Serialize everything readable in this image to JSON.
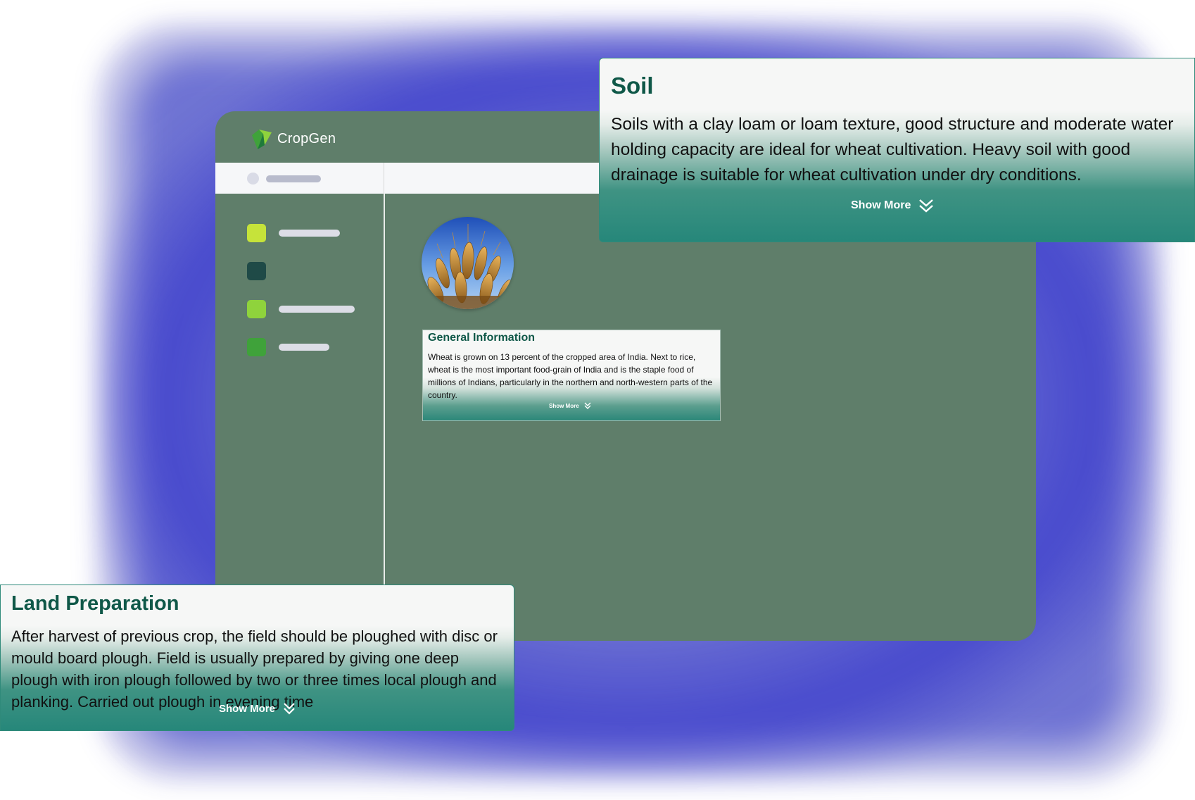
{
  "app": {
    "brand": "CropGen"
  },
  "colors": {
    "app_bg": "#5f7e6a",
    "accent_teal": "#0f5848",
    "nav_1": "#c6e33a",
    "nav_2": "#1f4a47",
    "nav_3": "#8fd33c",
    "nav_4": "#3fa23a"
  },
  "sidebar": {
    "items": [
      {
        "icon": "lime-square-icon",
        "color": "#c6e33a"
      },
      {
        "icon": "dark-teal-square-icon",
        "color": "#1f4a47"
      },
      {
        "icon": "green-square-icon",
        "color": "#8fd33c"
      },
      {
        "icon": "forest-green-square-icon",
        "color": "#3fa23a"
      }
    ]
  },
  "main": {
    "crop_image": "wheat-image",
    "general_info": {
      "title": "General Information",
      "body": "Wheat is grown on 13 percent of the cropped area of India. Next to rice, wheat is the most important food-grain of India and is the staple food of millions of Indians, particularly in the northern and north-western parts of the country.",
      "show_more": "Show More"
    }
  },
  "soil_card": {
    "title": "Soil",
    "body": "Soils with a clay loam or loam texture, good structure and moderate water holding capacity are ideal for wheat cultivation. Heavy soil with good drainage is suitable for wheat cultivation under dry conditions.",
    "show_more": "Show More"
  },
  "land_card": {
    "title": "Land Preparation",
    "body": "After harvest of previous crop, the field should be ploughed with disc or mould board plough. Field is usually prepared by giving one deep plough with iron plough followed by two or three times local plough and planking. Carried out plough in evening time",
    "show_more": "Show More"
  }
}
